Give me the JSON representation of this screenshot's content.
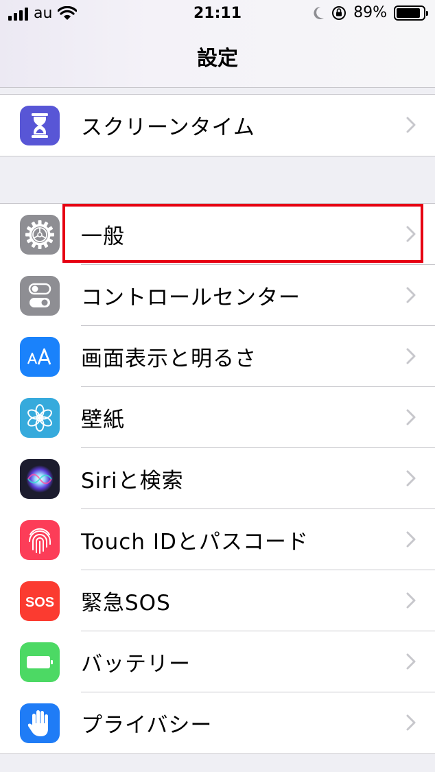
{
  "status_bar": {
    "carrier": "au",
    "time": "21:11",
    "battery_percent": "89%",
    "battery_level": 0.89,
    "icons": [
      "signal-icon",
      "wifi-icon",
      "moon-icon",
      "orientation-lock-icon",
      "battery-icon"
    ]
  },
  "nav": {
    "title": "設定"
  },
  "groups": [
    {
      "items": [
        {
          "label": "スクリーンタイム",
          "icon": "hourglass-icon",
          "color": "#5856d6"
        }
      ]
    },
    {
      "items": [
        {
          "label": "一般",
          "icon": "gear-icon",
          "color": "#8e8e93",
          "highlighted": true
        },
        {
          "label": "コントロールセンター",
          "icon": "toggle-switches-icon",
          "color": "#8e8e93"
        },
        {
          "label": "画面表示と明るさ",
          "icon": "text-size-icon",
          "color": "#1a82fb"
        },
        {
          "label": "壁紙",
          "icon": "flower-icon",
          "color": "#36aadc"
        },
        {
          "label": "Siriと検索",
          "icon": "siri-icon",
          "color": "#1c1c2e"
        },
        {
          "label": "Touch IDとパスコード",
          "icon": "fingerprint-icon",
          "color": "#fc3d58"
        },
        {
          "label": "緊急SOS",
          "icon": "sos-icon",
          "color": "#fb3b30"
        },
        {
          "label": "バッテリー",
          "icon": "battery-icon",
          "color": "#4cd964"
        },
        {
          "label": "プライバシー",
          "icon": "hand-icon",
          "color": "#1f7cf6"
        }
      ]
    }
  ],
  "highlight_color": "#e60012"
}
